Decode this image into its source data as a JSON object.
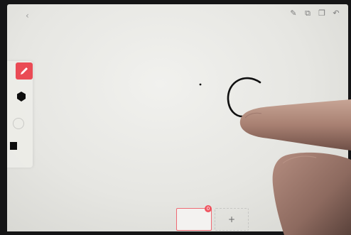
{
  "toolbar": {
    "back_icon": "‹",
    "top_icons": [
      "pen-outline-icon",
      "copy-icon",
      "layers-icon",
      "undo-icon"
    ],
    "top_glyphs": [
      "✎",
      "⧉",
      "❐",
      "↶"
    ]
  },
  "palette": {
    "items": [
      "pen-icon",
      "hexagon-icon",
      "circle-icon",
      "square-icon"
    ],
    "selected": "pen-icon",
    "accent": "#ea4b55"
  },
  "pages": {
    "current_badge": "0",
    "add_label": "+"
  }
}
